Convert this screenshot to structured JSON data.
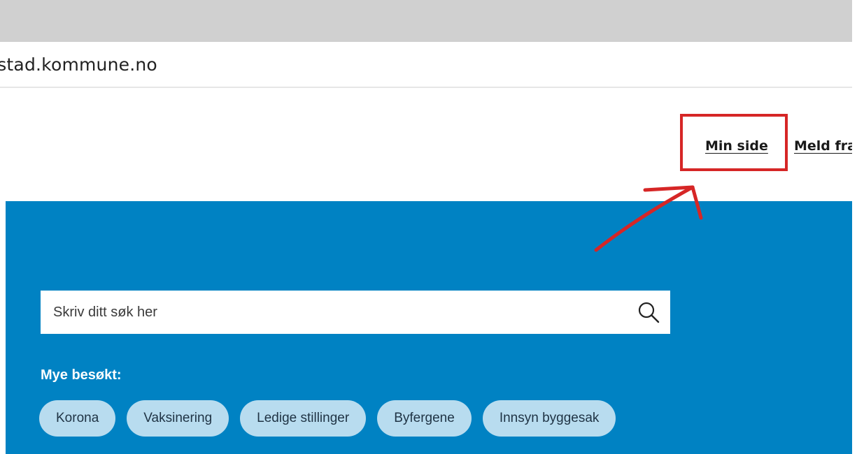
{
  "address_bar": {
    "url_text": "‹stad.kommune.no"
  },
  "header_links": {
    "min_side": "Min side",
    "meld_fra": "Meld fra"
  },
  "search": {
    "placeholder": "Skriv ditt søk her",
    "icon": "search-icon"
  },
  "popular": {
    "heading": "Mye besøkt:",
    "chips": [
      "Korona",
      "Vaksinering",
      "Ledige stillinger",
      "Byfergene",
      "Innsyn byggesak"
    ]
  },
  "colors": {
    "hero_blue": "#0082c3",
    "chip_bg": "#b8dcef",
    "annotation_red": "#d62626",
    "browser_gray": "#d0d0d0"
  }
}
